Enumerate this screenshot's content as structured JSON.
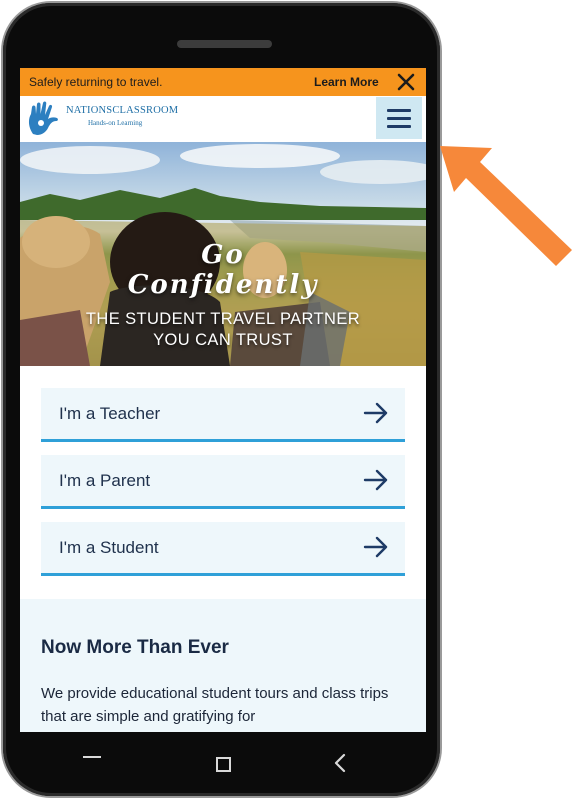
{
  "banner": {
    "text": "Safely returning to travel.",
    "link": "Learn More",
    "close_icon": "close-x-icon",
    "color": "#f6941d"
  },
  "header": {
    "logo_name": "NATIONSCLASSROOM",
    "logo_tagline": "Hands-on Learning",
    "logo_icon": "hand-logo-icon",
    "menu_icon": "hamburger-menu-icon"
  },
  "hero": {
    "title_line1": "Go",
    "title_line2": "Confidently",
    "subtitle_line1": "THE STUDENT TRAVEL PARTNER",
    "subtitle_line2": "YOU CAN TRUST"
  },
  "audience_links": [
    {
      "label": "I'm a Teacher",
      "icon": "arrow-right-icon"
    },
    {
      "label": "I'm a Parent",
      "icon": "arrow-right-icon"
    },
    {
      "label": "I'm a Student",
      "icon": "arrow-right-icon"
    }
  ],
  "section": {
    "title": "Now More Than Ever",
    "body": "We provide educational student tours and class trips that are simple and gratifying for"
  },
  "android_nav": {
    "home_icon": "home-bar-icon",
    "recents_icon": "square-recents-icon",
    "back_icon": "back-chevron-icon"
  },
  "colors": {
    "accent_orange": "#f6941d",
    "link_underline": "#2fa0d8",
    "card_bg": "#eef7fb",
    "menu_button_bg": "#cfe8f2",
    "navy": "#1e3b66",
    "annotation_arrow": "#f6883a"
  }
}
